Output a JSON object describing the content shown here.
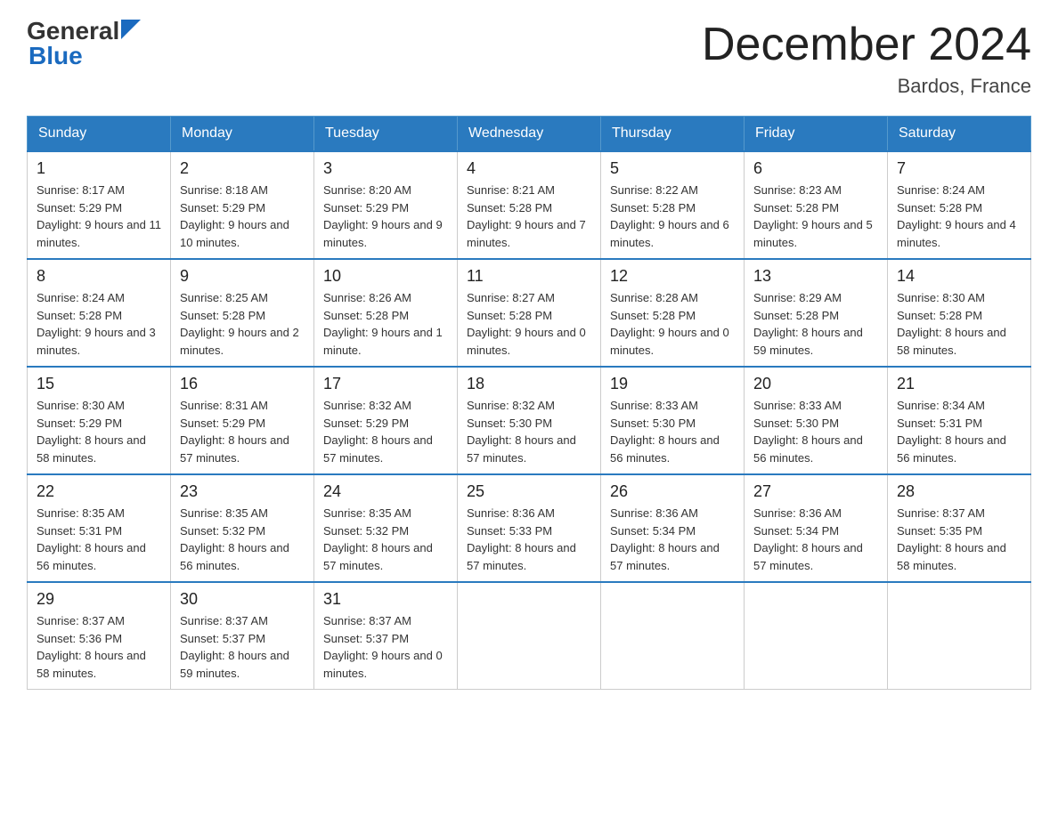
{
  "header": {
    "logo_general": "General",
    "logo_blue": "Blue",
    "month_title": "December 2024",
    "location": "Bardos, France"
  },
  "calendar": {
    "days_of_week": [
      "Sunday",
      "Monday",
      "Tuesday",
      "Wednesday",
      "Thursday",
      "Friday",
      "Saturday"
    ],
    "weeks": [
      [
        {
          "day": "1",
          "sunrise": "8:17 AM",
          "sunset": "5:29 PM",
          "daylight": "9 hours and 11 minutes."
        },
        {
          "day": "2",
          "sunrise": "8:18 AM",
          "sunset": "5:29 PM",
          "daylight": "9 hours and 10 minutes."
        },
        {
          "day": "3",
          "sunrise": "8:20 AM",
          "sunset": "5:29 PM",
          "daylight": "9 hours and 9 minutes."
        },
        {
          "day": "4",
          "sunrise": "8:21 AM",
          "sunset": "5:28 PM",
          "daylight": "9 hours and 7 minutes."
        },
        {
          "day": "5",
          "sunrise": "8:22 AM",
          "sunset": "5:28 PM",
          "daylight": "9 hours and 6 minutes."
        },
        {
          "day": "6",
          "sunrise": "8:23 AM",
          "sunset": "5:28 PM",
          "daylight": "9 hours and 5 minutes."
        },
        {
          "day": "7",
          "sunrise": "8:24 AM",
          "sunset": "5:28 PM",
          "daylight": "9 hours and 4 minutes."
        }
      ],
      [
        {
          "day": "8",
          "sunrise": "8:24 AM",
          "sunset": "5:28 PM",
          "daylight": "9 hours and 3 minutes."
        },
        {
          "day": "9",
          "sunrise": "8:25 AM",
          "sunset": "5:28 PM",
          "daylight": "9 hours and 2 minutes."
        },
        {
          "day": "10",
          "sunrise": "8:26 AM",
          "sunset": "5:28 PM",
          "daylight": "9 hours and 1 minute."
        },
        {
          "day": "11",
          "sunrise": "8:27 AM",
          "sunset": "5:28 PM",
          "daylight": "9 hours and 0 minutes."
        },
        {
          "day": "12",
          "sunrise": "8:28 AM",
          "sunset": "5:28 PM",
          "daylight": "9 hours and 0 minutes."
        },
        {
          "day": "13",
          "sunrise": "8:29 AM",
          "sunset": "5:28 PM",
          "daylight": "8 hours and 59 minutes."
        },
        {
          "day": "14",
          "sunrise": "8:30 AM",
          "sunset": "5:28 PM",
          "daylight": "8 hours and 58 minutes."
        }
      ],
      [
        {
          "day": "15",
          "sunrise": "8:30 AM",
          "sunset": "5:29 PM",
          "daylight": "8 hours and 58 minutes."
        },
        {
          "day": "16",
          "sunrise": "8:31 AM",
          "sunset": "5:29 PM",
          "daylight": "8 hours and 57 minutes."
        },
        {
          "day": "17",
          "sunrise": "8:32 AM",
          "sunset": "5:29 PM",
          "daylight": "8 hours and 57 minutes."
        },
        {
          "day": "18",
          "sunrise": "8:32 AM",
          "sunset": "5:30 PM",
          "daylight": "8 hours and 57 minutes."
        },
        {
          "day": "19",
          "sunrise": "8:33 AM",
          "sunset": "5:30 PM",
          "daylight": "8 hours and 56 minutes."
        },
        {
          "day": "20",
          "sunrise": "8:33 AM",
          "sunset": "5:30 PM",
          "daylight": "8 hours and 56 minutes."
        },
        {
          "day": "21",
          "sunrise": "8:34 AM",
          "sunset": "5:31 PM",
          "daylight": "8 hours and 56 minutes."
        }
      ],
      [
        {
          "day": "22",
          "sunrise": "8:35 AM",
          "sunset": "5:31 PM",
          "daylight": "8 hours and 56 minutes."
        },
        {
          "day": "23",
          "sunrise": "8:35 AM",
          "sunset": "5:32 PM",
          "daylight": "8 hours and 56 minutes."
        },
        {
          "day": "24",
          "sunrise": "8:35 AM",
          "sunset": "5:32 PM",
          "daylight": "8 hours and 57 minutes."
        },
        {
          "day": "25",
          "sunrise": "8:36 AM",
          "sunset": "5:33 PM",
          "daylight": "8 hours and 57 minutes."
        },
        {
          "day": "26",
          "sunrise": "8:36 AM",
          "sunset": "5:34 PM",
          "daylight": "8 hours and 57 minutes."
        },
        {
          "day": "27",
          "sunrise": "8:36 AM",
          "sunset": "5:34 PM",
          "daylight": "8 hours and 57 minutes."
        },
        {
          "day": "28",
          "sunrise": "8:37 AM",
          "sunset": "5:35 PM",
          "daylight": "8 hours and 58 minutes."
        }
      ],
      [
        {
          "day": "29",
          "sunrise": "8:37 AM",
          "sunset": "5:36 PM",
          "daylight": "8 hours and 58 minutes."
        },
        {
          "day": "30",
          "sunrise": "8:37 AM",
          "sunset": "5:37 PM",
          "daylight": "8 hours and 59 minutes."
        },
        {
          "day": "31",
          "sunrise": "8:37 AM",
          "sunset": "5:37 PM",
          "daylight": "9 hours and 0 minutes."
        },
        null,
        null,
        null,
        null
      ]
    ]
  }
}
